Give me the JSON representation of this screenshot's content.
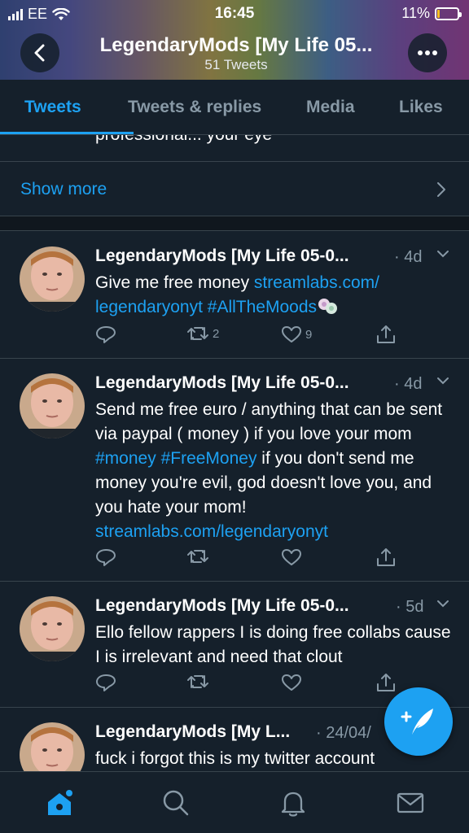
{
  "status_bar": {
    "carrier": "EE",
    "time": "16:45",
    "battery_percent": "11%",
    "battery_level": 0.11
  },
  "header": {
    "title": "LegendaryMods [My Life 05...",
    "subtitle": "51 Tweets"
  },
  "tabs": [
    {
      "label": "Tweets",
      "active": true
    },
    {
      "label": "Tweets & replies",
      "active": false
    },
    {
      "label": "Media",
      "active": false
    },
    {
      "label": "Likes",
      "active": false
    }
  ],
  "truncated_text": "professional... your eye",
  "show_more": {
    "label": "Show more"
  },
  "tweets": [
    {
      "name": "LegendaryMods [My Life 05-0...",
      "time": "· 4d",
      "text_plain_1": "Give me free money ",
      "link_1": "streamlabs.com/",
      "link_2": "legendaryonyt",
      "hashtag_1": " #AllTheMoods",
      "retweets": "2",
      "likes": "9"
    },
    {
      "name": "LegendaryMods [My Life 05-0...",
      "time": "· 4d",
      "text_plain_1": "Send me free euro / anything that can be sent via paypal ( money ) if you love your mom ",
      "hashtag_1": "#money",
      "hashtag_2": "#FreeMoney",
      "text_plain_2": "  if you don't send me money you're evil, god doesn't love you, and you hate your mom!",
      "link_1": "streamlabs.com/legendaryonyt",
      "retweets": "",
      "likes": ""
    },
    {
      "name": "LegendaryMods [My Life 05-0...",
      "time": "· 5d",
      "text_plain_1": "Ello fellow rappers I is doing free collabs cause I is irrelevant and need that clout",
      "retweets": "",
      "likes": ""
    },
    {
      "name": "LegendaryMods [My L...",
      "time": "· 24/04/",
      "text_plain_1": "fuck i forgot this is my twitter account"
    }
  ],
  "colors": {
    "background": "#15202b",
    "accent": "#1da1f2",
    "secondary_text": "#8899a6",
    "divider": "#38444d"
  },
  "icons": {
    "back": "chevron-left-icon",
    "more": "ellipsis-icon",
    "reply": "reply-icon",
    "retweet": "retweet-icon",
    "like": "heart-icon",
    "share": "share-icon",
    "compose": "compose-feather-icon",
    "home": "home-icon",
    "search": "search-icon",
    "notifications": "bell-icon",
    "messages": "mail-icon"
  }
}
